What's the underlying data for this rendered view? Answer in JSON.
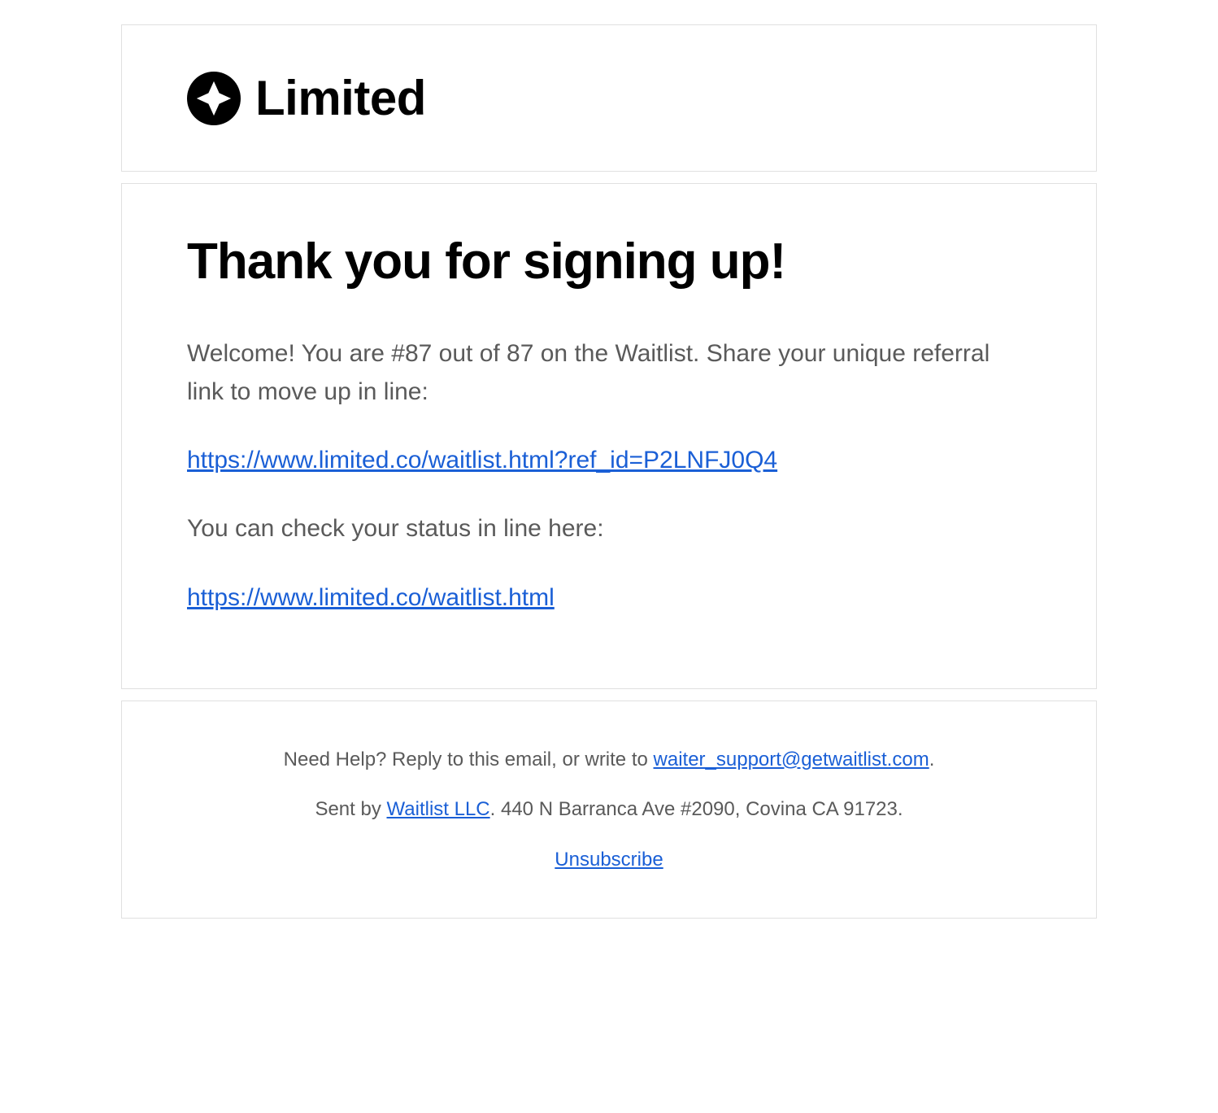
{
  "header": {
    "brand_name": "Limited"
  },
  "body": {
    "title": "Thank you for signing up!",
    "welcome_text": "Welcome! You are #87 out of 87 on the Waitlist. Share your unique referral link to move up in line:",
    "referral_link": "https://www.limited.co/waitlist.html?ref_id=P2LNFJ0Q4",
    "status_text": "You can check your status in line here:",
    "status_link": "https://www.limited.co/waitlist.html"
  },
  "footer": {
    "help_prefix": "Need Help? Reply to this email, or write to ",
    "help_email": "waiter_support@getwaitlist.com",
    "help_suffix": ".",
    "sent_prefix": "Sent by ",
    "sent_link": "Waitlist LLC",
    "sent_suffix": ". 440 N Barranca Ave #2090, Covina CA 91723.",
    "unsubscribe": "Unsubscribe"
  }
}
